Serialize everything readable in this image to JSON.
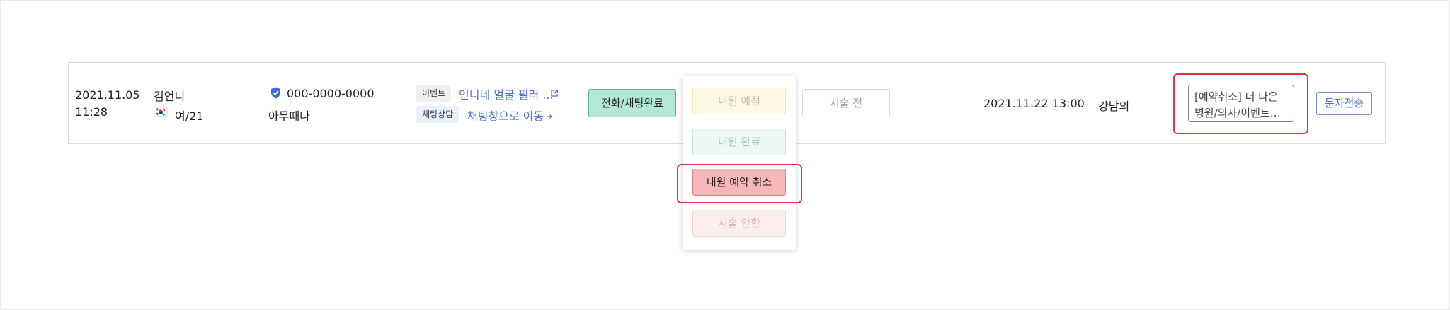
{
  "row": {
    "datetime_date": "2021.11.05",
    "datetime_time": "11:28",
    "customer_name": "김언니",
    "customer_flag": "🇰🇷",
    "customer_info": "여/21",
    "phone": "000-0000-0000",
    "phone_sub": "아무때나",
    "source_tag": "이벤트",
    "source_link": "언니네 얼굴 필러 ...",
    "channel_tag": "채팅상담",
    "channel_link": "채팅창으로 이동",
    "status_button": "전화/채팅완료",
    "treatment_button": "시술 전",
    "reservation_datetime": "2021.11.22 13:00",
    "doctor": "강남의",
    "memo": "[예약취소] 더 나은 병원/의사/이벤트…",
    "sms_button": "문자전송"
  },
  "dropdown": {
    "items": [
      "내원 예정",
      "내원 완료",
      "내원 예약 취소",
      "시술 안함"
    ]
  },
  "colors": {
    "status_green": "#b6e8d8",
    "highlight_red": "#e03238",
    "link_blue": "#4a74d8"
  }
}
